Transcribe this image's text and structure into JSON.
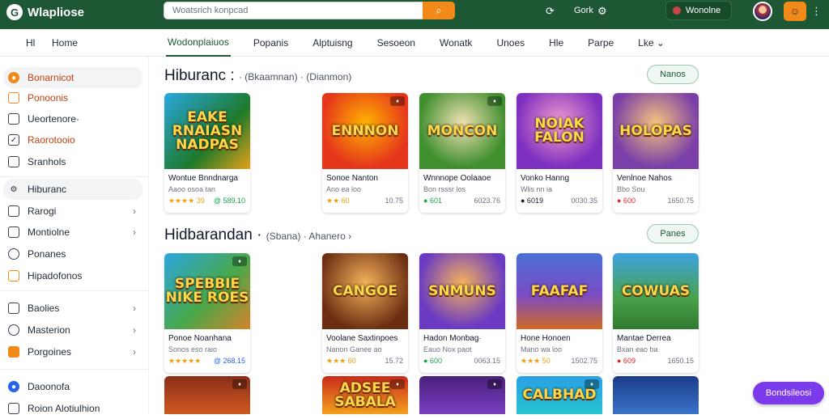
{
  "topbar": {
    "logo": "Wlapliose",
    "search_placeholder": "Woatsrich konpcad",
    "search_icon": "search-icon",
    "refresh_icon": "refresh-icon",
    "user_text": "Gork",
    "profile_name": "Wonolne",
    "menu_icon": "menu-dots-icon"
  },
  "nav": {
    "left_label": "Hl",
    "home_label": "Home",
    "tabs": [
      "Wodonplaiuos",
      "Popanis",
      "Alptuisng",
      "Sesoeon",
      "Wonatk",
      "Unoes",
      "Hle",
      "Parpe",
      "Lke ⌄"
    ]
  },
  "sidebar": {
    "items": [
      {
        "label": "Bonarnicot"
      },
      {
        "label": "Ponoonis"
      },
      {
        "label": "Ueortenore·"
      },
      {
        "label": "Raorotooio"
      },
      {
        "label": "Sranhols"
      },
      {
        "label": "Hiburanc"
      },
      {
        "label": "Rarogi"
      },
      {
        "label": "Montiolne"
      },
      {
        "label": "Ponanes"
      },
      {
        "label": "Hipadofonos"
      },
      {
        "label": "Baolies"
      },
      {
        "label": "Masterion"
      },
      {
        "label": "Porgoines"
      },
      {
        "label": "Daoonofa"
      },
      {
        "label": "Roion Alotiulhion"
      }
    ]
  },
  "section1": {
    "title": "Hiburanc :",
    "sub": "· (Bkaamnan) · (Dianmon)",
    "button": "Nanos",
    "cards": [
      {
        "art": "EAKE RNAIASN NADPAS",
        "name": "Wontue Bnndnarga",
        "meta": "Aaoo osoa  tan",
        "rating": "★★★★ 39",
        "right": "@ 589.10"
      },
      {
        "art": "ENNNON",
        "name": "Sonoe Nanton",
        "meta": "Ano  ea  loo",
        "rating": "★★ 60",
        "right": "10.75"
      },
      {
        "art": "MONCON",
        "name": "Wnnnope Oolaaoe",
        "meta": "Bon  rsssr  los",
        "rating": "● 601",
        "right": "6023.76"
      },
      {
        "art": "NOIAK FALON",
        "name": "Vonko Hanng",
        "meta": "Wlis  nn  ia",
        "rating": "● 6019",
        "right": "0030.35"
      },
      {
        "art": "HOLOPAS",
        "name": "Venlnoe Nahos",
        "meta": "Bbo  Sou",
        "rating": "● 600",
        "right": "1650.75"
      }
    ]
  },
  "section2": {
    "title": "Hidbarandan ·",
    "sub": "(Sbana) · Ahanero ›",
    "button": "Panes",
    "cards": [
      {
        "art": "SPEBBIE NIKE ROES",
        "name": "Ponoe Noanhana",
        "meta": "Sonos  eso  raio",
        "rating": "★★★★★",
        "right": "@ 268.15"
      },
      {
        "art": "CANGOE",
        "name": "Voolane Saxtinpoes",
        "meta": "Nanon  Ganee  ao",
        "rating": "★★★ 60",
        "right": "15.72"
      },
      {
        "art": "SNMUNS",
        "name": "Hadon Monbag·",
        "meta": "Eauo  Nox  paot",
        "rating": "● 600",
        "right": "0063.15"
      },
      {
        "art": "FAAFAF",
        "name": "Hone Honoen",
        "meta": "Mano  wa  loo",
        "rating": "★★★ 50",
        "right": "1502.75"
      },
      {
        "art": "COWUAS",
        "name": "Mantae Derrea",
        "meta": "Bxan  eao  ba",
        "rating": "● 609",
        "right": "1650.15"
      }
    ]
  },
  "section3": {
    "cards": [
      {
        "art": ""
      },
      {
        "art": "ADSEE SABALA"
      },
      {
        "art": ""
      },
      {
        "art": "CALBHAD"
      },
      {
        "art": ""
      }
    ]
  },
  "fab": {
    "label": "Bondsileosi"
  },
  "colors": {
    "topbar": "#1d5733",
    "accent": "#f28a1a",
    "fab": "#7c3aed"
  }
}
